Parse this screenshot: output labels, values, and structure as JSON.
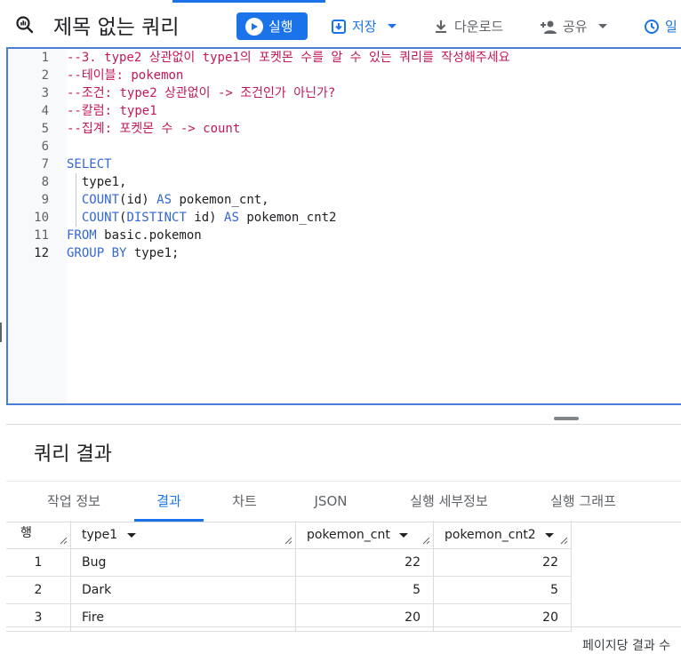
{
  "toolbar": {
    "title": "제목 없는 쿼리",
    "run_label": "실행",
    "save_label": "저장",
    "download_label": "다운로드",
    "share_label": "공유",
    "schedule_label": "일"
  },
  "editor": {
    "lines": [
      {
        "n": "1",
        "text": "--3. type2 상관없이 type1의 포켓몬 수를 알 수 있는 쿼리를 작성해주세요",
        "cls": "cm"
      },
      {
        "n": "2",
        "text": "--테이블: pokemon",
        "cls": "cm"
      },
      {
        "n": "3",
        "text": "--조건: type2 상관없이 -> 조건인가 아닌가?",
        "cls": "cm"
      },
      {
        "n": "4",
        "text": "--칼럼: type1",
        "cls": "cm"
      },
      {
        "n": "5",
        "text": "--집계: 포켓몬 수 -> count",
        "cls": "cm"
      },
      {
        "n": "6",
        "text": "",
        "cls": "pl"
      },
      {
        "n": "7",
        "text": "SELECT",
        "cls": "kw"
      },
      {
        "n": "8",
        "text": "  type1,",
        "cls": "pl"
      },
      {
        "n": "9",
        "text": "  COUNT(id) AS pokemon_cnt,",
        "cls": "mix9"
      },
      {
        "n": "10",
        "text": "  COUNT(DISTINCT id) AS pokemon_cnt2",
        "cls": "mix10"
      },
      {
        "n": "11",
        "text": "FROM basic.pokemon",
        "cls": "mix11"
      },
      {
        "n": "12",
        "text": "GROUP BY type1;",
        "cls": "mix12"
      }
    ]
  },
  "results": {
    "title": "쿼리 결과",
    "tabs": [
      "작업 정보",
      "결과",
      "차트",
      "JSON",
      "실행 세부정보",
      "실행 그래프"
    ],
    "active_tab": "결과",
    "columns": [
      "행",
      "type1",
      "pokemon_cnt",
      "pokemon_cnt2"
    ],
    "rows": [
      {
        "row": "1",
        "type1": "Bug",
        "pokemon_cnt": "22",
        "pokemon_cnt2": "22"
      },
      {
        "row": "2",
        "type1": "Dark",
        "pokemon_cnt": "5",
        "pokemon_cnt2": "5"
      },
      {
        "row": "3",
        "type1": "Fire",
        "pokemon_cnt": "20",
        "pokemon_cnt2": "20"
      }
    ],
    "footer": "페이지당 결과 수"
  },
  "colors": {
    "accent": "#1a73e8",
    "comment": "#c2185b",
    "keyword": "#3367d6"
  }
}
